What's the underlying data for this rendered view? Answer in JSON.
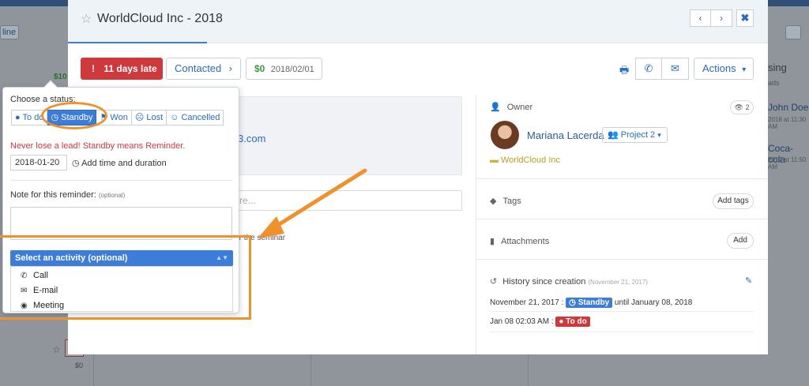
{
  "background": {
    "left_button_label": "line",
    "green_value": "$10",
    "card_value": "$0",
    "right_column_title": "sing",
    "right_column_sub": "ads",
    "right_items": [
      {
        "name": "John Doe",
        "date": "2018 at 11:30 AM"
      },
      {
        "name": "Coca-cola",
        "date": "2017 at 11:50 AM"
      }
    ]
  },
  "modal": {
    "title": "WorldCloud Inc - 2018",
    "prev_icon": "‹",
    "next_icon": "›",
    "close_icon": "✖"
  },
  "toolbar": {
    "late_label": "11 days late",
    "late_icon": "!",
    "contacted_label": "Contacted",
    "contacted_chevron": "›",
    "amount": "$0",
    "date": "2018/02/01",
    "actions_label": "Actions",
    "actions_caret": "▾"
  },
  "contact": {
    "email_partial": "3.com",
    "note_placeholder": "re...",
    "seminar_text": "e for the seminar"
  },
  "status_popover": {
    "label": "Choose a status:",
    "statuses": [
      {
        "label": "To do",
        "icon": "●",
        "active": false
      },
      {
        "label": "Standby",
        "icon": "◷",
        "active": true
      },
      {
        "label": "Won",
        "icon": "⚑",
        "active": false
      },
      {
        "label": "Lost",
        "icon": "☹",
        "active": false
      },
      {
        "label": "Cancelled",
        "icon": "☺",
        "active": false
      }
    ],
    "warning": "Never lose a lead! Standby means Reminder.",
    "date_value": "2018-01-20",
    "add_time": "Add time and duration",
    "note_label": "Note for this reminder:",
    "note_optional": "(optional)",
    "activity_placeholder": "Select an activity (optional)",
    "activities": [
      {
        "label": "Call",
        "icon": "✆"
      },
      {
        "label": "E-mail",
        "icon": "✉"
      },
      {
        "label": "Meeting",
        "icon": "◉"
      }
    ]
  },
  "owner": {
    "label": "Owner",
    "viewers": "2",
    "name": "Mariana Lacerda",
    "project": "Project 2",
    "company": "WorldCloud Inc"
  },
  "tags": {
    "label": "Tags",
    "button": "Add tags"
  },
  "attachments": {
    "label": "Attachments",
    "button": "Add"
  },
  "history": {
    "title": "History since creation",
    "since": "(November 21, 2017)",
    "rows": [
      {
        "date": "November 21, 2017 :",
        "tag": "Standby",
        "tail": "until January 08, 2018"
      },
      {
        "date": "Jan 08 02:03 AM :",
        "tag": "To do",
        "tail": ""
      }
    ]
  },
  "colors": {
    "accent": "#3b7dd8",
    "danger": "#d0393c",
    "success": "#3a9a3a",
    "annotation": "#f0922c"
  }
}
